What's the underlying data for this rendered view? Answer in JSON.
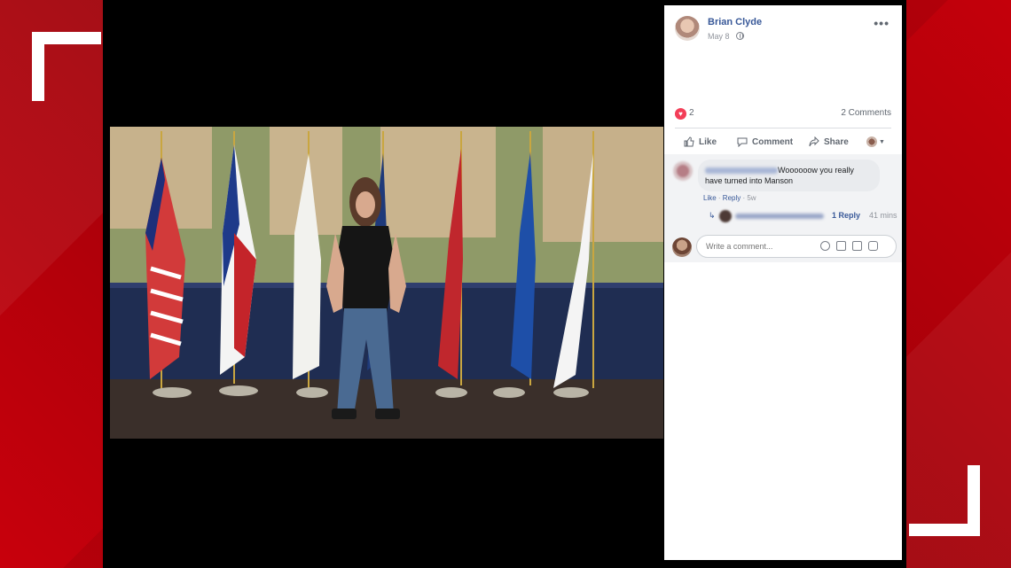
{
  "post": {
    "author": "Brian Clyde",
    "date": "May 8",
    "reaction_count": "2",
    "comments_label": "2 Comments",
    "actions": {
      "like": "Like",
      "comment": "Comment",
      "share": "Share"
    }
  },
  "comment": {
    "text_line1": "Woooooow you really",
    "text_line2": "have turned into Manson",
    "like": "Like",
    "reply": "Reply",
    "age": "5w",
    "reply_link": "1 Reply",
    "reply_time": "41 mins"
  },
  "compose": {
    "placeholder": "Write a comment..."
  },
  "colors": {
    "accent": "#385898",
    "heart": "#f33e58",
    "frame_red": "#b3000a"
  },
  "icons": [
    "more-icon",
    "globe-icon",
    "heart-icon",
    "like-icon",
    "comment-icon",
    "share-icon",
    "emoji-icon",
    "camera-icon",
    "gif-icon",
    "sticker-icon"
  ]
}
